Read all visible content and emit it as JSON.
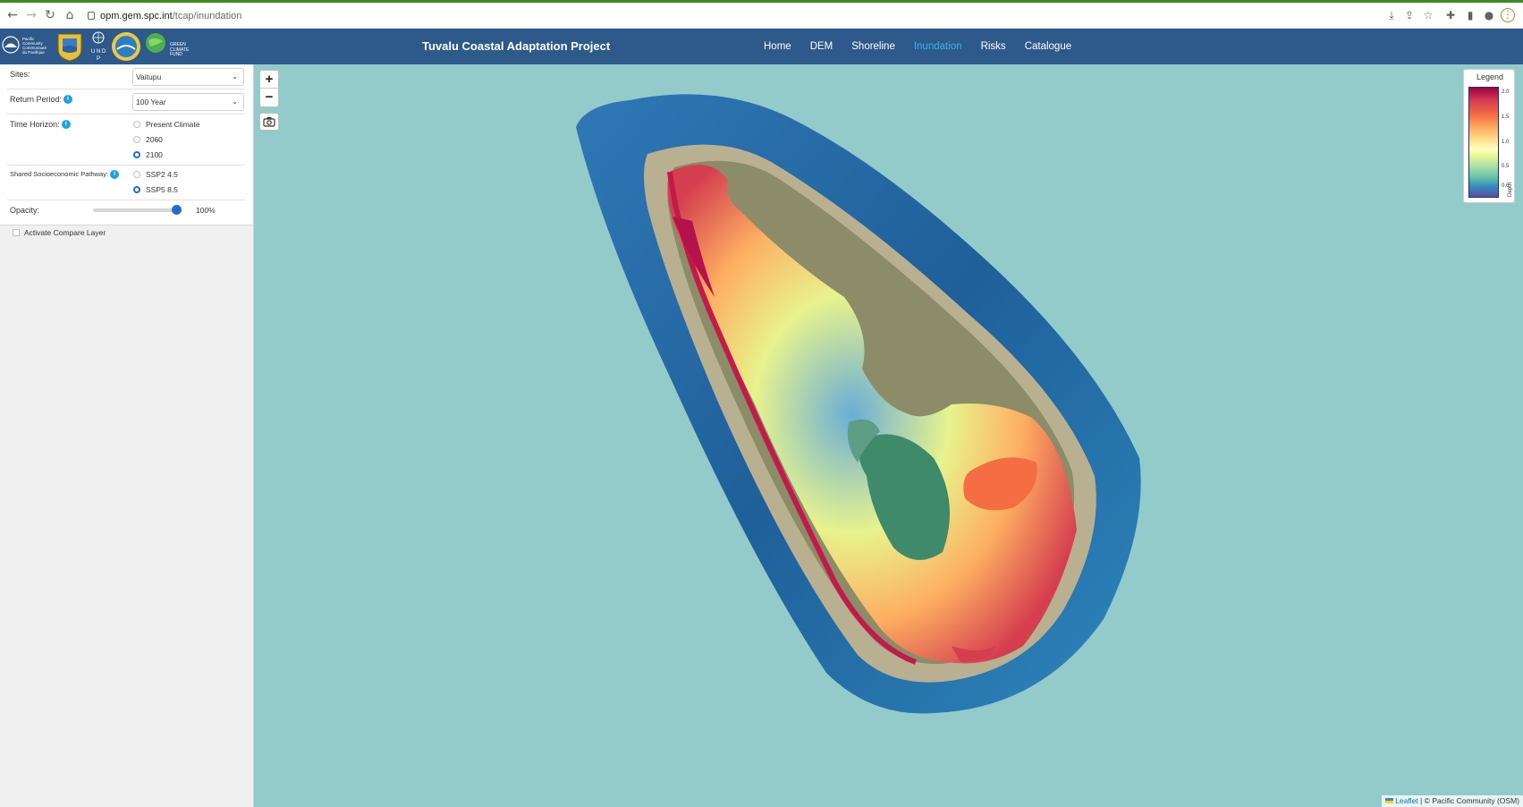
{
  "browser": {
    "url_host": "opm.gem.spc.int",
    "url_path": "/tcap/inundation"
  },
  "header": {
    "logo_text_1": "Pacific Community",
    "logo_text_2": "Communauté du Pacifique",
    "logo_undp": "U N D P",
    "logo_gcf": "GREEN CLIMATE FUND",
    "title": "Tuvalu Coastal Adaptation Project",
    "nav": [
      {
        "label": "Home"
      },
      {
        "label": "DEM"
      },
      {
        "label": "Shoreline"
      },
      {
        "label": "Inundation"
      },
      {
        "label": "Risks"
      },
      {
        "label": "Catalogue"
      }
    ],
    "active_nav": "Inundation",
    "bg_color": "#2d5a8b",
    "active_color": "#3db1e8"
  },
  "sidebar": {
    "sites_label": "Sites:",
    "sites_value": "Vaitupu",
    "return_period_label": "Return Period:",
    "return_period_value": "100 Year",
    "time_horizon_label": "Time Horizon:",
    "time_horizon_options": [
      "Present Climate",
      "2060",
      "2100"
    ],
    "time_horizon_selected": "2100",
    "ssp_label": "Shared Socioeconomic Pathway:",
    "ssp_options": [
      "SSP2 4.5",
      "SSP5 8.5"
    ],
    "ssp_selected": "SSP5 8.5",
    "opacity_label": "Opacity:",
    "opacity_value": "100%",
    "compare_label": "Activate Compare Layer",
    "info_glyph": "i"
  },
  "map": {
    "zoom_in": "+",
    "zoom_out": "−",
    "legend_title": "Legend",
    "legend_ticks": [
      "2.0",
      "1.5",
      "1.0",
      "0.5",
      "0.0"
    ],
    "legend_axis": "Depth",
    "attribution_leaflet": "Leaflet",
    "attribution_rest": " | © Pacific Community (OSM)",
    "water_color": "#92cbc9"
  }
}
